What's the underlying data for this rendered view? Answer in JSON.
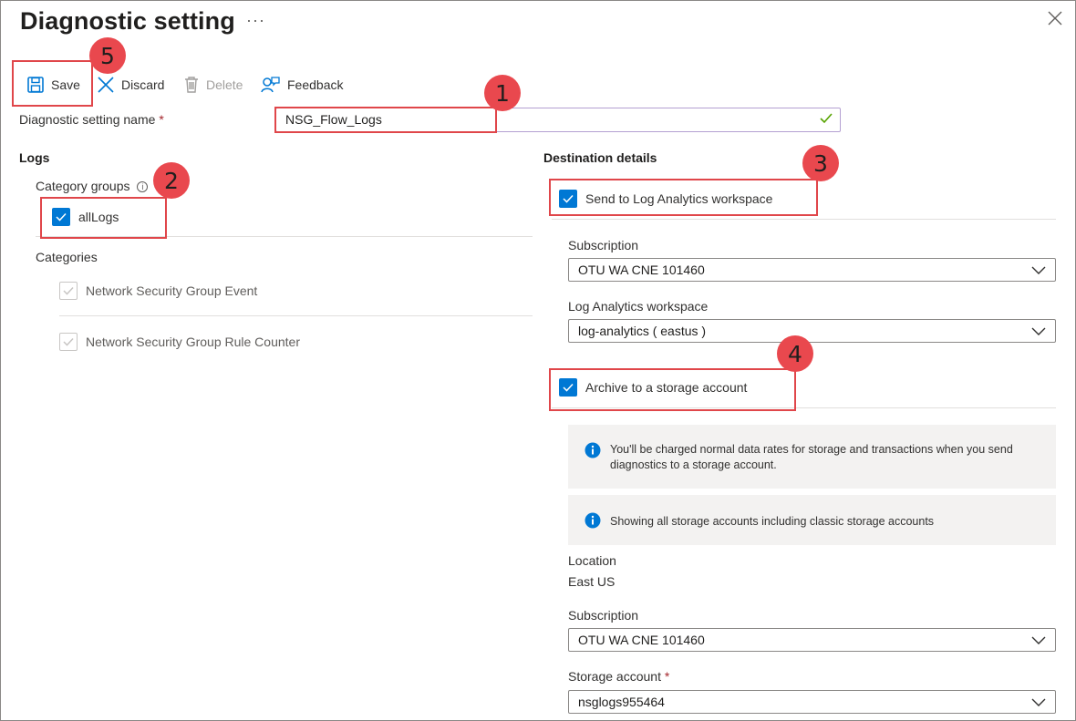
{
  "header": {
    "title": "Diagnostic setting",
    "more": "···",
    "close_label": "✕"
  },
  "toolbar": {
    "save": "Save",
    "discard": "Discard",
    "delete": "Delete",
    "feedback": "Feedback"
  },
  "setting_name": {
    "label": "Diagnostic setting name",
    "required_mark": "*",
    "value": "NSG_Flow_Logs"
  },
  "logs": {
    "heading": "Logs",
    "category_groups_label": "Category groups",
    "info_icon": "ⓘ",
    "all_logs_label": "allLogs",
    "all_logs_checked": true,
    "categories_label": "Categories",
    "categories": [
      {
        "label": "Network Security Group Event",
        "checked": true,
        "disabled": true
      },
      {
        "label": "Network Security Group Rule Counter",
        "checked": true,
        "disabled": true
      }
    ]
  },
  "destination": {
    "heading": "Destination details",
    "log_analytics": {
      "label": "Send to Log Analytics workspace",
      "checked": true,
      "subscription_label": "Subscription",
      "subscription_value": "OTU WA CNE 101460",
      "workspace_label": "Log Analytics workspace",
      "workspace_value": "log-analytics ( eastus )"
    },
    "storage": {
      "label": "Archive to a storage account",
      "checked": true,
      "info_charge": "You'll be charged normal data rates for storage and transactions when you send diagnostics to a storage account.",
      "info_classic": "Showing all storage accounts including classic storage accounts",
      "location_label": "Location",
      "location_value": "East US",
      "subscription_label": "Subscription",
      "subscription_value": "OTU WA CNE 101460",
      "account_label": "Storage account",
      "account_required": "*",
      "account_value": "nsglogs955464"
    }
  },
  "callouts": [
    "1",
    "2",
    "3",
    "4",
    "5"
  ],
  "colors": {
    "accent": "#0078d4",
    "callout": "#e0464a",
    "valid": "#57a300"
  }
}
